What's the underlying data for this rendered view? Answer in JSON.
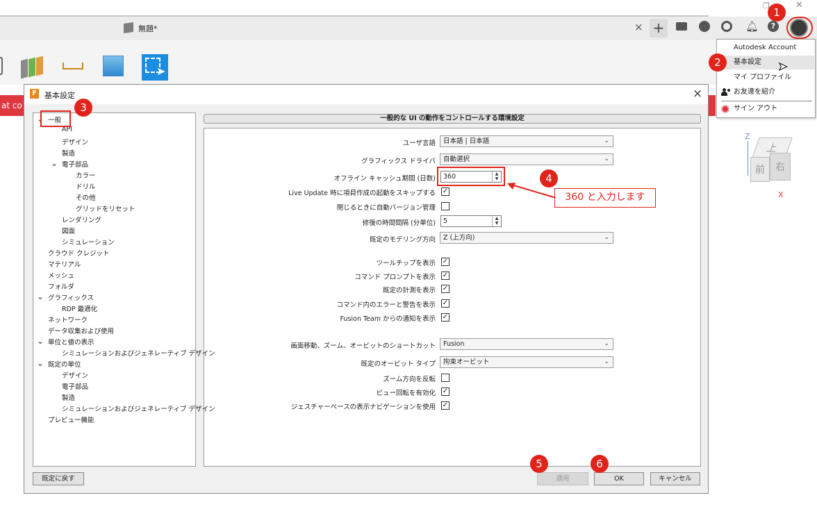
{
  "window": {
    "title": "無題*",
    "tab_close": "×"
  },
  "toolbar_right": {
    "add": "+",
    "chat": "chat",
    "help": "?"
  },
  "left_strip_text": "at co",
  "account_menu": {
    "items": [
      {
        "label": "Autodesk Account"
      },
      {
        "label": "基本設定"
      },
      {
        "label": "マイ プロファイル"
      },
      {
        "label": "お友達を紹介"
      },
      {
        "label": "サイン アウト"
      }
    ]
  },
  "dialog": {
    "title": "基本設定",
    "close": "×",
    "section_header": "一般的な UI の動作をコントロールする環境設定",
    "tree": [
      {
        "label": "一般",
        "chev": "⌄"
      },
      {
        "label": "API"
      },
      {
        "label": "デザイン"
      },
      {
        "label": "製造"
      },
      {
        "label": "電子部品",
        "chev": "⌄"
      },
      {
        "label": "カラー"
      },
      {
        "label": "ドリル"
      },
      {
        "label": "その他"
      },
      {
        "label": "グリッドをリセット"
      },
      {
        "label": "レンダリング"
      },
      {
        "label": "図面"
      },
      {
        "label": "シミュレーション"
      },
      {
        "label": "クラウド クレジット"
      },
      {
        "label": "マテリアル"
      },
      {
        "label": "メッシュ"
      },
      {
        "label": "フォルダ"
      },
      {
        "label": "グラフィックス",
        "chev": "⌄"
      },
      {
        "label": "RDP 最適化"
      },
      {
        "label": "ネットワーク"
      },
      {
        "label": "データ収集および使用"
      },
      {
        "label": "単位と値の表示",
        "chev": "⌄"
      },
      {
        "label": "シミュレーションおよびジェネレーティブ デザイン"
      },
      {
        "label": "既定の単位",
        "chev": "⌄"
      },
      {
        "label": "デザイン"
      },
      {
        "label": "電子部品"
      },
      {
        "label": "製造"
      },
      {
        "label": "シミュレーションおよびジェネレーティブ デザイン"
      },
      {
        "label": "プレビュー機能"
      }
    ],
    "settings": {
      "user_language": {
        "label": "ユーザ言語",
        "value": "日本語 | 日本語"
      },
      "graphics_driver": {
        "label": "グラフィックス ドライバ",
        "value": "自動選択"
      },
      "offline_cache": {
        "label": "オフライン キャッシュ期間 (日数)",
        "value": "360"
      },
      "live_update": {
        "label": "Live Update 時に項目作成の起動をスキップする",
        "checked": true
      },
      "auto_version": {
        "label": "閉じるときに自動バージョン管理",
        "checked": false
      },
      "recovery_interval": {
        "label": "修復の時間間隔 (分単位)",
        "value": "5"
      },
      "modeling_direction": {
        "label": "既定のモデリング方向",
        "value": "Z (上方向)"
      },
      "show_tooltips": {
        "label": "ツールチップを表示",
        "checked": true
      },
      "show_command_prompt": {
        "label": "コマンド プロンプトを表示",
        "checked": true
      },
      "show_default_measure": {
        "label": "既定の計測を表示",
        "checked": true
      },
      "show_command_errors": {
        "label": "コマンド内のエラーと警告を表示",
        "checked": true
      },
      "show_fusion_team": {
        "label": "Fusion Team からの通知を表示",
        "checked": true
      },
      "pan_zoom_shortcut": {
        "label": "画面移動、ズーム、オービットのショートカット",
        "value": "Fusion"
      },
      "default_orbit": {
        "label": "既定のオービット タイプ",
        "value": "拘束オービット"
      },
      "reverse_zoom": {
        "label": "ズーム方向を反転",
        "checked": false
      },
      "enable_view_rotate": {
        "label": "ビュー回転を有効化",
        "checked": true
      },
      "gesture_nav": {
        "label": "ジェスチャーベースの表示ナビゲーションを使用",
        "checked": true
      }
    },
    "buttons": {
      "restore": "既定に戻す",
      "apply": "適用",
      "ok": "OK",
      "cancel": "キャンセル"
    }
  },
  "annotations": {
    "badges": [
      "1",
      "2",
      "3",
      "4",
      "5",
      "6"
    ],
    "callout": "360 と入力します"
  },
  "viewcube": {
    "top": "上",
    "front": "前",
    "right": "右",
    "z": "Z",
    "x": "X"
  },
  "colors": {
    "annotation_red": "#e0241b",
    "autodesk_red": "#e0373f",
    "selection_blue": "#1c8de0"
  }
}
